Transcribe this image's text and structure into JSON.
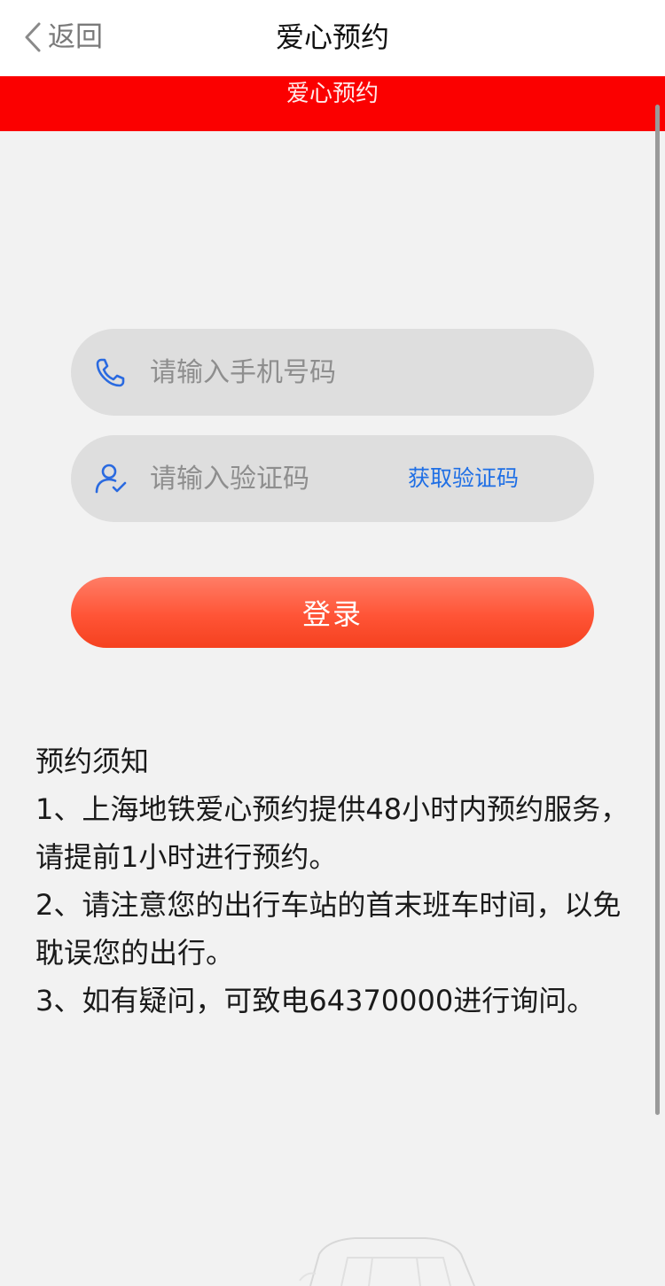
{
  "nav": {
    "back_label": "返回",
    "title": "爱心预约"
  },
  "banner": {
    "text": "爱心预约"
  },
  "form": {
    "phone_placeholder": "请输入手机号码",
    "code_placeholder": "请输入验证码",
    "get_code_label": "获取验证码",
    "login_label": "登录"
  },
  "notice": {
    "heading": "预约须知",
    "items": [
      "1、上海地铁爱心预约提供48小时内预约服务，请提前1小时进行预约。",
      "2、请注意您的出行车站的首末班车时间，以免耽误您的出行。",
      "3、如有疑问，可致电64370000进行询问。"
    ]
  },
  "icons": {
    "back": "chevron-left-icon",
    "phone": "phone-icon",
    "user": "user-check-icon"
  },
  "colors": {
    "banner": "#fb0000",
    "link": "#1f6fe5",
    "button_top": "#ff7d66",
    "button_bottom": "#f5411f",
    "field_bg": "#dedede",
    "page_bg": "#f2f2f2"
  }
}
